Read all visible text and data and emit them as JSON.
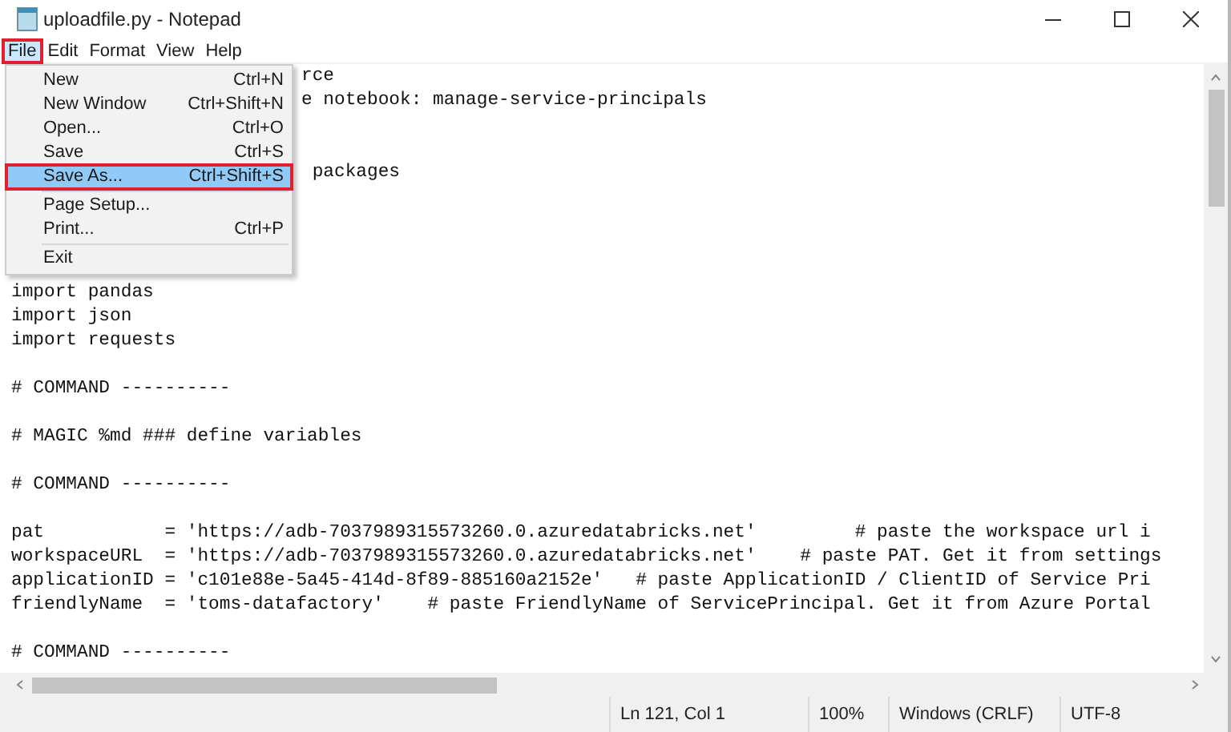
{
  "window": {
    "title": "uploadfile.py - Notepad"
  },
  "menubar": [
    {
      "label": "File",
      "selected": true,
      "annotated": true
    },
    {
      "label": "Edit",
      "selected": false,
      "annotated": false
    },
    {
      "label": "Format",
      "selected": false,
      "annotated": false
    },
    {
      "label": "View",
      "selected": false,
      "annotated": false
    },
    {
      "label": "Help",
      "selected": false,
      "annotated": false
    }
  ],
  "file_menu": [
    {
      "kind": "item",
      "label": "New",
      "shortcut": "Ctrl+N",
      "selected": false,
      "annotated": false
    },
    {
      "kind": "item",
      "label": "New Window",
      "shortcut": "Ctrl+Shift+N",
      "selected": false,
      "annotated": false
    },
    {
      "kind": "item",
      "label": "Open...",
      "shortcut": "Ctrl+O",
      "selected": false,
      "annotated": false
    },
    {
      "kind": "item",
      "label": "Save",
      "shortcut": "Ctrl+S",
      "selected": false,
      "annotated": false
    },
    {
      "kind": "item",
      "label": "Save As...",
      "shortcut": "Ctrl+Shift+S",
      "selected": true,
      "annotated": true
    },
    {
      "kind": "separator"
    },
    {
      "kind": "item",
      "label": "Page Setup...",
      "selected": false,
      "annotated": false
    },
    {
      "kind": "item",
      "label": "Print...",
      "shortcut": "Ctrl+P",
      "selected": false,
      "annotated": false
    },
    {
      "kind": "separator"
    },
    {
      "kind": "item",
      "label": "Exit",
      "selected": false,
      "annotated": false
    }
  ],
  "editor": {
    "lines": [
      {
        "kind": "fragment",
        "text": "rce"
      },
      {
        "kind": "fragment",
        "text": "e notebook: manage-service-principals"
      },
      {
        "kind": "blank"
      },
      {
        "kind": "blank"
      },
      {
        "kind": "fragment",
        "text": " packages"
      },
      {
        "kind": "blank"
      },
      {
        "kind": "blank"
      },
      {
        "kind": "blank"
      },
      {
        "kind": "blank"
      },
      {
        "kind": "line",
        "text": "import pandas"
      },
      {
        "kind": "line",
        "text": "import json"
      },
      {
        "kind": "line",
        "text": "import requests"
      },
      {
        "kind": "blank"
      },
      {
        "kind": "line",
        "text": "# COMMAND ----------"
      },
      {
        "kind": "blank"
      },
      {
        "kind": "line",
        "text": "# MAGIC %md ### define variables"
      },
      {
        "kind": "blank"
      },
      {
        "kind": "line",
        "text": "# COMMAND ----------"
      },
      {
        "kind": "blank"
      },
      {
        "kind": "line",
        "text": "pat           = 'https://adb-7037989315573260.0.azuredatabricks.net'         # paste the workspace url i"
      },
      {
        "kind": "line",
        "text": "workspaceURL  = 'https://adb-7037989315573260.0.azuredatabricks.net'    # paste PAT. Get it from settings"
      },
      {
        "kind": "line",
        "text": "applicationID = 'c101e88e-5a45-414d-8f89-885160a2152e'   # paste ApplicationID / ClientID of Service Pri"
      },
      {
        "kind": "line",
        "text": "friendlyName  = 'toms-datafactory'    # paste FriendlyName of ServicePrincipal. Get it from Azure Portal"
      },
      {
        "kind": "blank"
      },
      {
        "kind": "line",
        "text": "# COMMAND ----------"
      }
    ]
  },
  "status_bar": [
    "Ln 121, Col 1",
    "100%",
    "Windows (CRLF)",
    "UTF-8"
  ]
}
